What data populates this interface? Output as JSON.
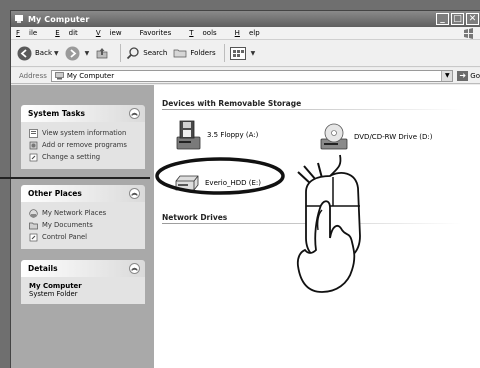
{
  "window": {
    "title": "My Computer"
  },
  "menu": [
    {
      "label": "File",
      "key": "F",
      "rest": "ile"
    },
    {
      "label": "Edit",
      "key": "E",
      "rest": "dit"
    },
    {
      "label": "View",
      "key": "V",
      "rest": "iew"
    },
    {
      "label": "Favorites",
      "key": "",
      "rest": "Favorites"
    },
    {
      "label": "Tools",
      "key": "T",
      "rest": "ools"
    },
    {
      "label": "Help",
      "key": "H",
      "rest": "elp"
    }
  ],
  "toolbar": {
    "back": "Back",
    "search": "Search",
    "folders": "Folders"
  },
  "address": {
    "label": "Address",
    "value": "My Computer",
    "go": "Go"
  },
  "system_tasks": {
    "title": "System Tasks",
    "items": [
      "View system information",
      "Add or remove programs",
      "Change a setting"
    ]
  },
  "other_places": {
    "title": "Other Places",
    "items": [
      "My Network Places",
      "My Documents",
      "Control Panel"
    ]
  },
  "details": {
    "title": "Details",
    "name": "My Computer",
    "type": "System Folder"
  },
  "removable": {
    "title": "Devices with Removable Storage",
    "drives": [
      "3.5 Floppy (A:)",
      "DVD/CD-RW Drive (D:)",
      "Everio_HDD (E:)"
    ]
  },
  "network": {
    "title": "Network Drives"
  },
  "colors": {
    "titlebar": "#6f6f6f",
    "left_pane": "#a9a9a9",
    "content_bg": "#ffffff"
  }
}
